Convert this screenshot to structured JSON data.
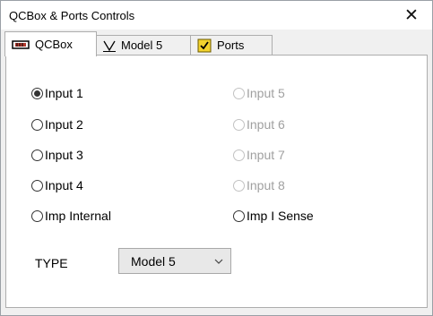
{
  "window": {
    "title": "QCBox & Ports Controls",
    "close_glyph": "✕"
  },
  "tabs": [
    {
      "label": "QCBox",
      "icon": "qcbox-device-icon",
      "active": true
    },
    {
      "label": "Model 5",
      "icon": "model5-v-icon",
      "active": false
    },
    {
      "label": "Ports",
      "icon": "ports-check-icon",
      "active": false
    }
  ],
  "inputs": {
    "left": [
      {
        "label": "Input 1",
        "checked": true,
        "enabled": true
      },
      {
        "label": "Input 2",
        "checked": false,
        "enabled": true
      },
      {
        "label": "Input 3",
        "checked": false,
        "enabled": true
      },
      {
        "label": "Input 4",
        "checked": false,
        "enabled": true
      },
      {
        "label": "Imp Internal",
        "checked": false,
        "enabled": true
      }
    ],
    "right": [
      {
        "label": "Input 5",
        "checked": false,
        "enabled": false
      },
      {
        "label": "Input 6",
        "checked": false,
        "enabled": false
      },
      {
        "label": "Input 7",
        "checked": false,
        "enabled": false
      },
      {
        "label": "Input 8",
        "checked": false,
        "enabled": false
      },
      {
        "label": "Imp I Sense",
        "checked": false,
        "enabled": true
      }
    ]
  },
  "type_field": {
    "label": "TYPE",
    "value": "Model 5"
  },
  "colors": {
    "panel": "#ffffff",
    "window_bg": "#f0f0f0",
    "disabled_text": "#a0a0a0",
    "ports_icon_yellow": "#f2d22e"
  }
}
